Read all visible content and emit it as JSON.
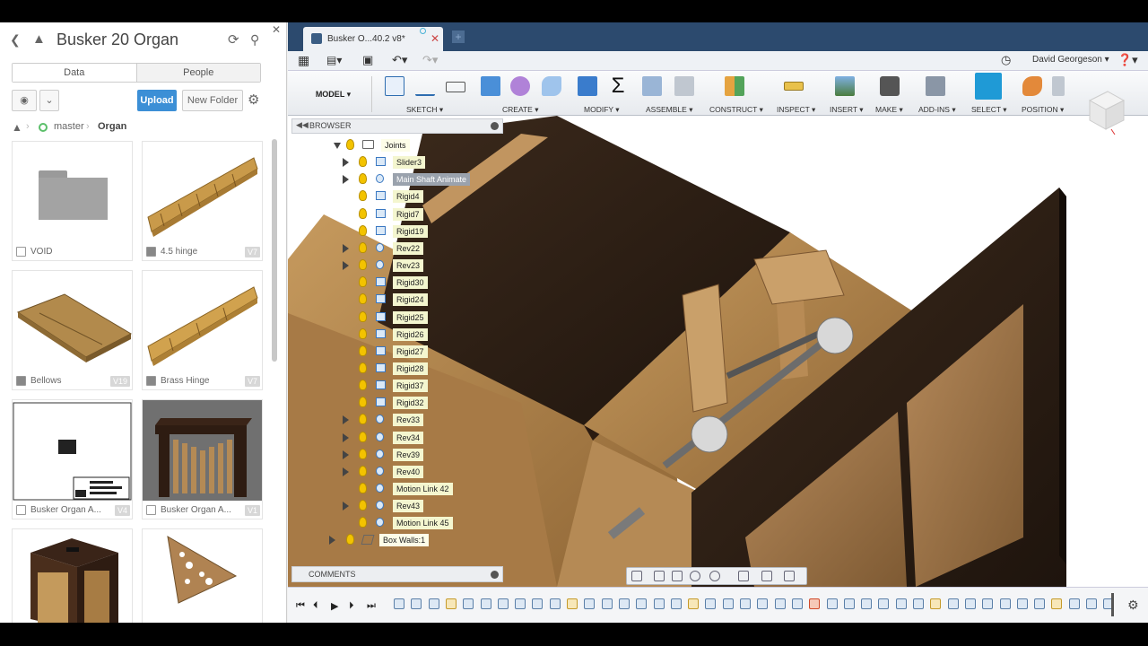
{
  "data_panel": {
    "title": "Busker 20 Organ",
    "tabs": [
      "Data",
      "People"
    ],
    "upload_label": "Upload",
    "new_folder_label": "New Folder",
    "breadcrumb": [
      "master",
      "Organ"
    ],
    "items": [
      {
        "name": "VOID",
        "type": "folder",
        "version": ""
      },
      {
        "name": "4.5 hinge",
        "type": "design",
        "version": "V7"
      },
      {
        "name": "Bellows",
        "type": "design",
        "version": "V19"
      },
      {
        "name": "Brass Hinge",
        "type": "design",
        "version": "V7"
      },
      {
        "name": "Busker Organ A...",
        "type": "drawing",
        "version": "V4"
      },
      {
        "name": "Busker Organ A...",
        "type": "render",
        "version": "V1"
      },
      {
        "name": "",
        "type": "design",
        "version": ""
      },
      {
        "name": "",
        "type": "design",
        "version": ""
      }
    ]
  },
  "app": {
    "document_tab": "Busker O...40.2 v8*",
    "user": "David Georgeson",
    "workspace": "MODEL",
    "groups": [
      "SKETCH",
      "CREATE",
      "MODIFY",
      "ASSEMBLE",
      "CONSTRUCT",
      "INSPECT",
      "INSERT",
      "MAKE",
      "ADD-INS",
      "SELECT",
      "POSITION"
    ],
    "browser_label": "BROWSER",
    "comments_label": "COMMENTS"
  },
  "tree": {
    "root": "Joints",
    "nodes": [
      {
        "label": "Slider3",
        "expandable": true,
        "kind": "slider"
      },
      {
        "label": "Main Shaft Animate",
        "expandable": true,
        "kind": "rev",
        "selected": true
      },
      {
        "label": "Rigid4",
        "expandable": false,
        "kind": "rigid"
      },
      {
        "label": "Rigid7",
        "expandable": false,
        "kind": "rigid"
      },
      {
        "label": "Rigid19",
        "expandable": false,
        "kind": "rigid"
      },
      {
        "label": "Rev22",
        "expandable": true,
        "kind": "rev"
      },
      {
        "label": "Rev23",
        "expandable": true,
        "kind": "rev"
      },
      {
        "label": "Rigid30",
        "expandable": false,
        "kind": "rigid"
      },
      {
        "label": "Rigid24",
        "expandable": false,
        "kind": "rigid"
      },
      {
        "label": "Rigid25",
        "expandable": false,
        "kind": "rigid"
      },
      {
        "label": "Rigid26",
        "expandable": false,
        "kind": "rigid"
      },
      {
        "label": "Rigid27",
        "expandable": false,
        "kind": "rigid"
      },
      {
        "label": "Rigid28",
        "expandable": false,
        "kind": "rigid"
      },
      {
        "label": "Rigid37",
        "expandable": false,
        "kind": "rigid"
      },
      {
        "label": "Rigid32",
        "expandable": false,
        "kind": "rigid"
      },
      {
        "label": "Rev33",
        "expandable": true,
        "kind": "rev"
      },
      {
        "label": "Rev34",
        "expandable": true,
        "kind": "rev"
      },
      {
        "label": "Rev39",
        "expandable": true,
        "kind": "rev"
      },
      {
        "label": "Rev40",
        "expandable": true,
        "kind": "rev"
      },
      {
        "label": "Motion Link 42",
        "expandable": false,
        "kind": "link"
      },
      {
        "label": "Rev43",
        "expandable": true,
        "kind": "rev"
      },
      {
        "label": "Motion Link 45",
        "expandable": false,
        "kind": "link"
      }
    ],
    "footer": "Box Walls:1"
  }
}
